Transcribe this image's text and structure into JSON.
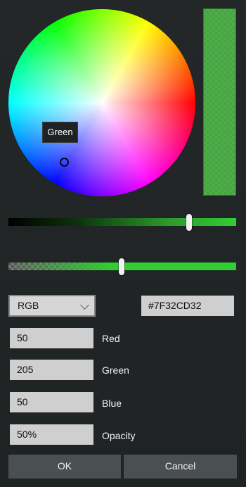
{
  "wheel": {
    "tooltip": "Green",
    "selected_color": "#32CD32"
  },
  "sliders": {
    "value_level": 0.8,
    "opacity_level": 0.5
  },
  "model": {
    "selected": "RGB"
  },
  "hex": {
    "value": "#7F32CD32"
  },
  "channels": [
    {
      "value": "50",
      "label": "Red"
    },
    {
      "value": "205",
      "label": "Green"
    },
    {
      "value": "50",
      "label": "Blue"
    },
    {
      "value": "50%",
      "label": "Opacity"
    }
  ],
  "buttons": {
    "ok": "OK",
    "cancel": "Cancel"
  },
  "icons": {
    "model_dropdown": "chevron-down-icon"
  }
}
